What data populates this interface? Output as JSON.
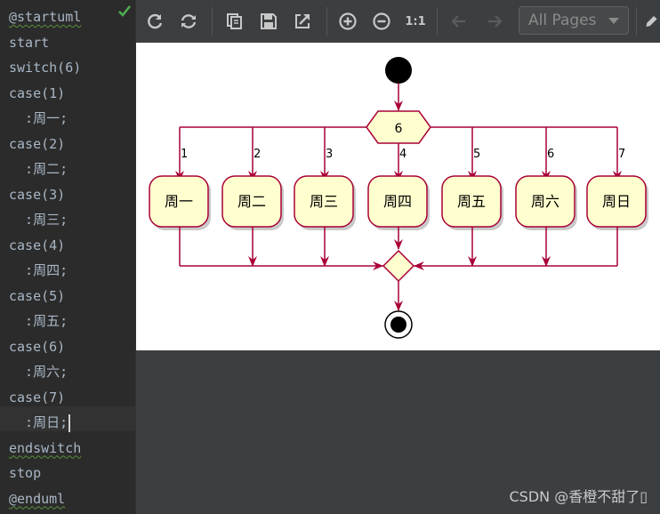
{
  "editor": {
    "lines": [
      "@startuml",
      "start",
      "switch(6)",
      "case(1)",
      "  :周一;",
      "case(2)",
      "  :周二;",
      "case(3)",
      "  :周三;",
      "case(4)",
      "  :周四;",
      "case(5)",
      "  :周五;",
      "case(6)",
      "  :周六;",
      "case(7)",
      "  :周日;",
      "endswitch",
      "stop",
      "@enduml"
    ]
  },
  "toolbar": {
    "pages_select_value": "All Pages",
    "zoom_actual_label": "1:1",
    "icons": [
      "refresh-icon",
      "sync-icon",
      "copy-icon",
      "save-icon",
      "external-icon",
      "zoom-in-icon",
      "zoom-out-icon",
      "arrow-left-icon",
      "arrow-right-icon",
      "pencil-icon"
    ]
  },
  "diagram": {
    "switch_label": "6",
    "branches": [
      {
        "case": "1",
        "label": "周一"
      },
      {
        "case": "2",
        "label": "周二"
      },
      {
        "case": "3",
        "label": "周三"
      },
      {
        "case": "4",
        "label": "周四"
      },
      {
        "case": "5",
        "label": "周五"
      },
      {
        "case": "6",
        "label": "周六"
      },
      {
        "case": "7",
        "label": "周日"
      }
    ],
    "colors": {
      "stroke": "#a80036",
      "node_fill": "#fefece"
    }
  },
  "watermark": "CSDN @香橙不甜了▯"
}
